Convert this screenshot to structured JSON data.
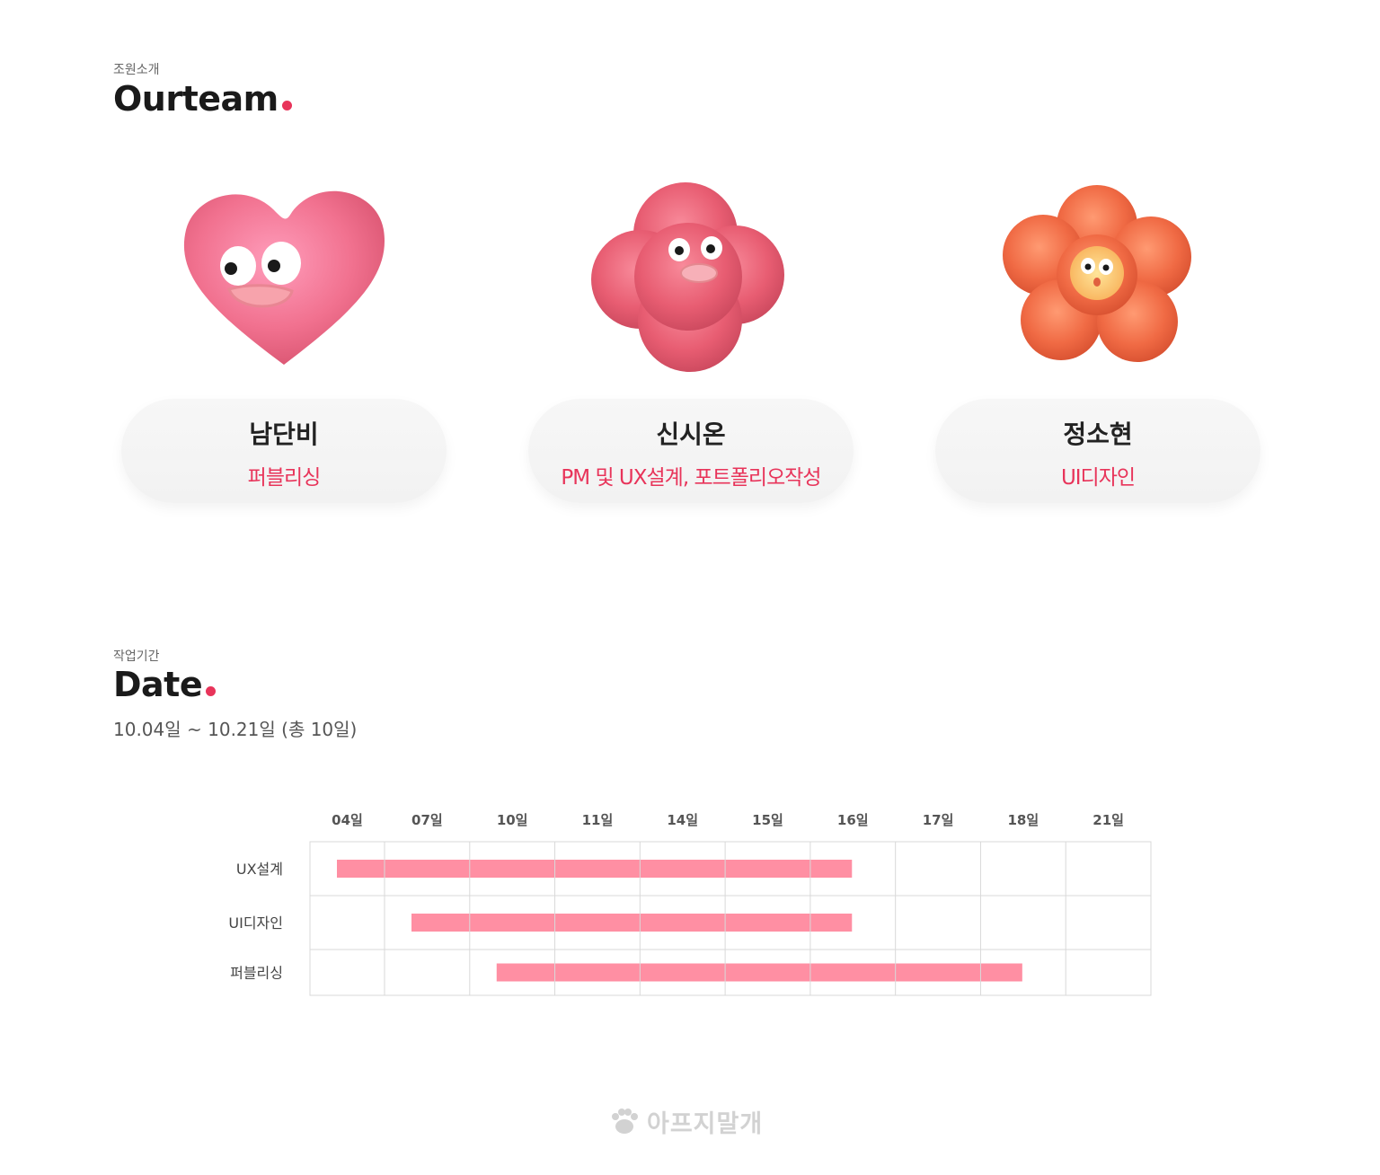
{
  "team_section": {
    "eyebrow": "조원소개",
    "title": "Ourteam",
    "members": [
      {
        "name": "남단비",
        "role": "퍼블리싱",
        "avatar": "pink-fluffy-heart-character"
      },
      {
        "name": "신시온",
        "role": "PM 및 UX설계, 포트폴리오작성",
        "avatar": "pink-fluffy-blob-character"
      },
      {
        "name": "정소현",
        "role": "UI디자인",
        "avatar": "orange-fluffy-flower-character"
      }
    ]
  },
  "date_section": {
    "eyebrow": "작업기간",
    "title": "Date",
    "range": "10.04일 ~ 10.21일 (총 10일)"
  },
  "chart_data": {
    "type": "bar",
    "orientation": "horizontal-gantt",
    "columns": [
      "04일",
      "07일",
      "10일",
      "11일",
      "14일",
      "15일",
      "16일",
      "17일",
      "18일",
      "21일"
    ],
    "tasks": [
      {
        "label": "UX설계",
        "start": "04일",
        "end": "16일"
      },
      {
        "label": "UI디자인",
        "start": "07일",
        "end": "16일"
      },
      {
        "label": "퍼블리싱",
        "start": "10일",
        "end": "18일"
      }
    ],
    "bar_color": "#ff8fa3",
    "grid": true
  },
  "footer": {
    "brand": "아프지말개",
    "icon": "paw-icon"
  },
  "colors": {
    "accent": "#e8345a",
    "card_bg": "#f5f5f5",
    "grid": "#d9d9d9"
  }
}
